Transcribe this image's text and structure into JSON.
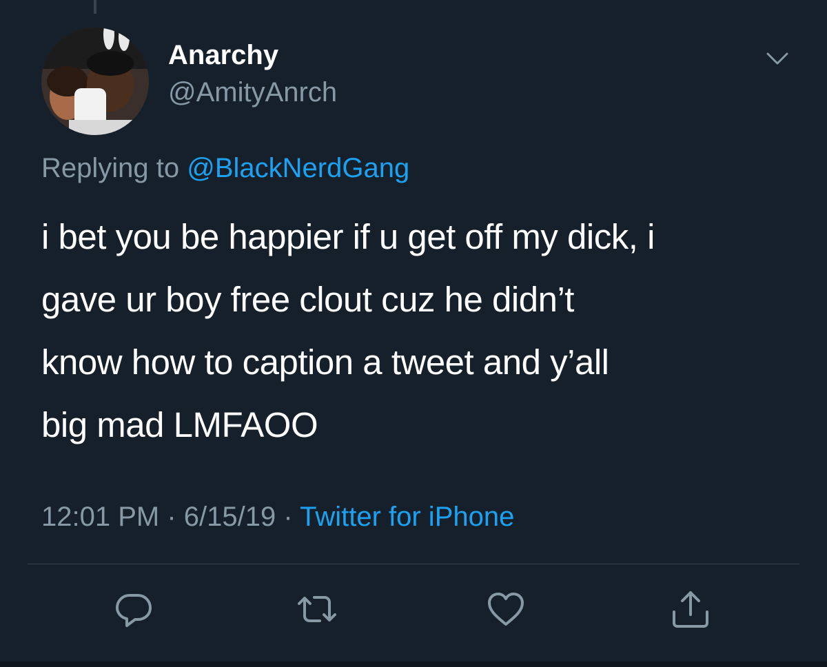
{
  "tweet": {
    "author": {
      "display_name": "Anarchy",
      "handle": "@AmityAnrch"
    },
    "reply": {
      "prefix": "Replying to",
      "handle": "@BlackNerdGang"
    },
    "text_lines": [
      "i bet you be happier if u get off my dick, i",
      "gave ur boy free clout cuz he didn’t",
      "know how to caption a tweet and y’all",
      "big mad LMFAOO"
    ],
    "time": "12:01 PM",
    "separator": "·",
    "date": "6/15/19",
    "source": "Twitter for iPhone"
  },
  "actions": [
    {
      "icon": "reply-icon"
    },
    {
      "icon": "retweet-icon"
    },
    {
      "icon": "like-icon"
    },
    {
      "icon": "share-icon"
    }
  ],
  "colors": {
    "background": "#15202b",
    "text_primary": "#ffffff",
    "text_secondary": "#8899a6",
    "accent": "#1da1f2",
    "divider": "#38444d"
  }
}
